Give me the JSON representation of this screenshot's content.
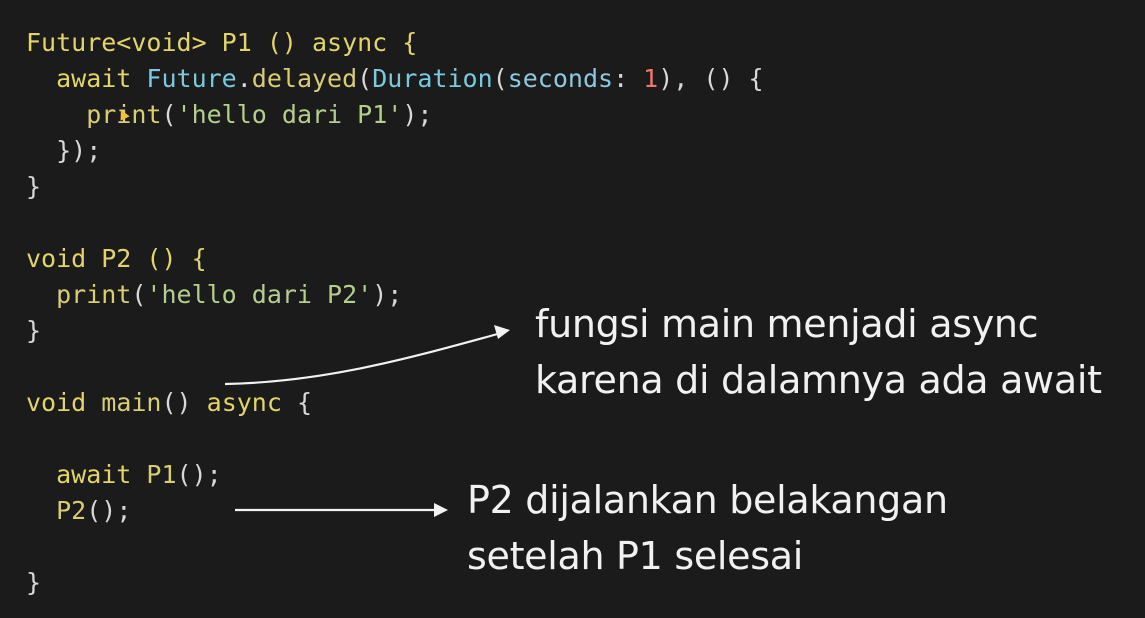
{
  "colors": {
    "background": "#1b1b1b",
    "keyword": "#e3d46a",
    "type": "#79c9e0",
    "func": "#d9cd73",
    "string": "#b5ce8d",
    "number": "#f07866",
    "plain": "#d8d8d8",
    "param": "#8ec7e0"
  },
  "code": {
    "lines": [
      [
        {
          "t": "Future<void> P1 () async {",
          "c": "keyword"
        }
      ],
      [
        {
          "t": "  await ",
          "c": "keyword"
        },
        {
          "t": "Future",
          "c": "type"
        },
        {
          "t": ".",
          "c": "plain"
        },
        {
          "t": "delayed",
          "c": "func"
        },
        {
          "t": "(",
          "c": "plain"
        },
        {
          "t": "Duration",
          "c": "type"
        },
        {
          "t": "(",
          "c": "plain"
        },
        {
          "t": "seconds",
          "c": "param"
        },
        {
          "t": ": ",
          "c": "plain"
        },
        {
          "t": "1",
          "c": "number"
        },
        {
          "t": "), () {",
          "c": "plain"
        }
      ],
      [
        {
          "t": "    print",
          "c": "func"
        },
        {
          "t": "(",
          "c": "plain"
        },
        {
          "t": "'hello dari P1'",
          "c": "string"
        },
        {
          "t": ");",
          "c": "plain"
        }
      ],
      [
        {
          "t": "  });",
          "c": "plain"
        }
      ],
      [
        {
          "t": "}",
          "c": "plain"
        }
      ],
      [
        {
          "t": "",
          "c": "plain"
        }
      ],
      [
        {
          "t": "void P2 () {",
          "c": "keyword"
        }
      ],
      [
        {
          "t": "  print",
          "c": "func"
        },
        {
          "t": "(",
          "c": "plain"
        },
        {
          "t": "'hello dari P2'",
          "c": "string"
        },
        {
          "t": ");",
          "c": "plain"
        }
      ],
      [
        {
          "t": "}",
          "c": "plain"
        }
      ],
      [
        {
          "t": "",
          "c": "plain"
        }
      ],
      [
        {
          "t": "void ",
          "c": "keyword"
        },
        {
          "t": "main",
          "c": "func"
        },
        {
          "t": "() ",
          "c": "plain"
        },
        {
          "t": "async",
          "c": "keyword"
        },
        {
          "t": " {",
          "c": "plain"
        }
      ],
      [
        {
          "t": "",
          "c": "plain"
        }
      ],
      [
        {
          "t": "  await ",
          "c": "keyword"
        },
        {
          "t": "P1",
          "c": "func"
        },
        {
          "t": "();",
          "c": "plain"
        }
      ],
      [
        {
          "t": "  P2",
          "c": "func"
        },
        {
          "t": "();",
          "c": "plain"
        }
      ],
      [
        {
          "t": "",
          "c": "plain"
        }
      ],
      [
        {
          "t": "}",
          "c": "plain"
        }
      ]
    ]
  },
  "notes": {
    "main_async_line1": "fungsi main menjadi async",
    "main_async_line2": "karena di dalamnya ada await",
    "p2_line1": "P2 dijalankan belakangan",
    "p2_line2": "setelah P1 selesai"
  }
}
